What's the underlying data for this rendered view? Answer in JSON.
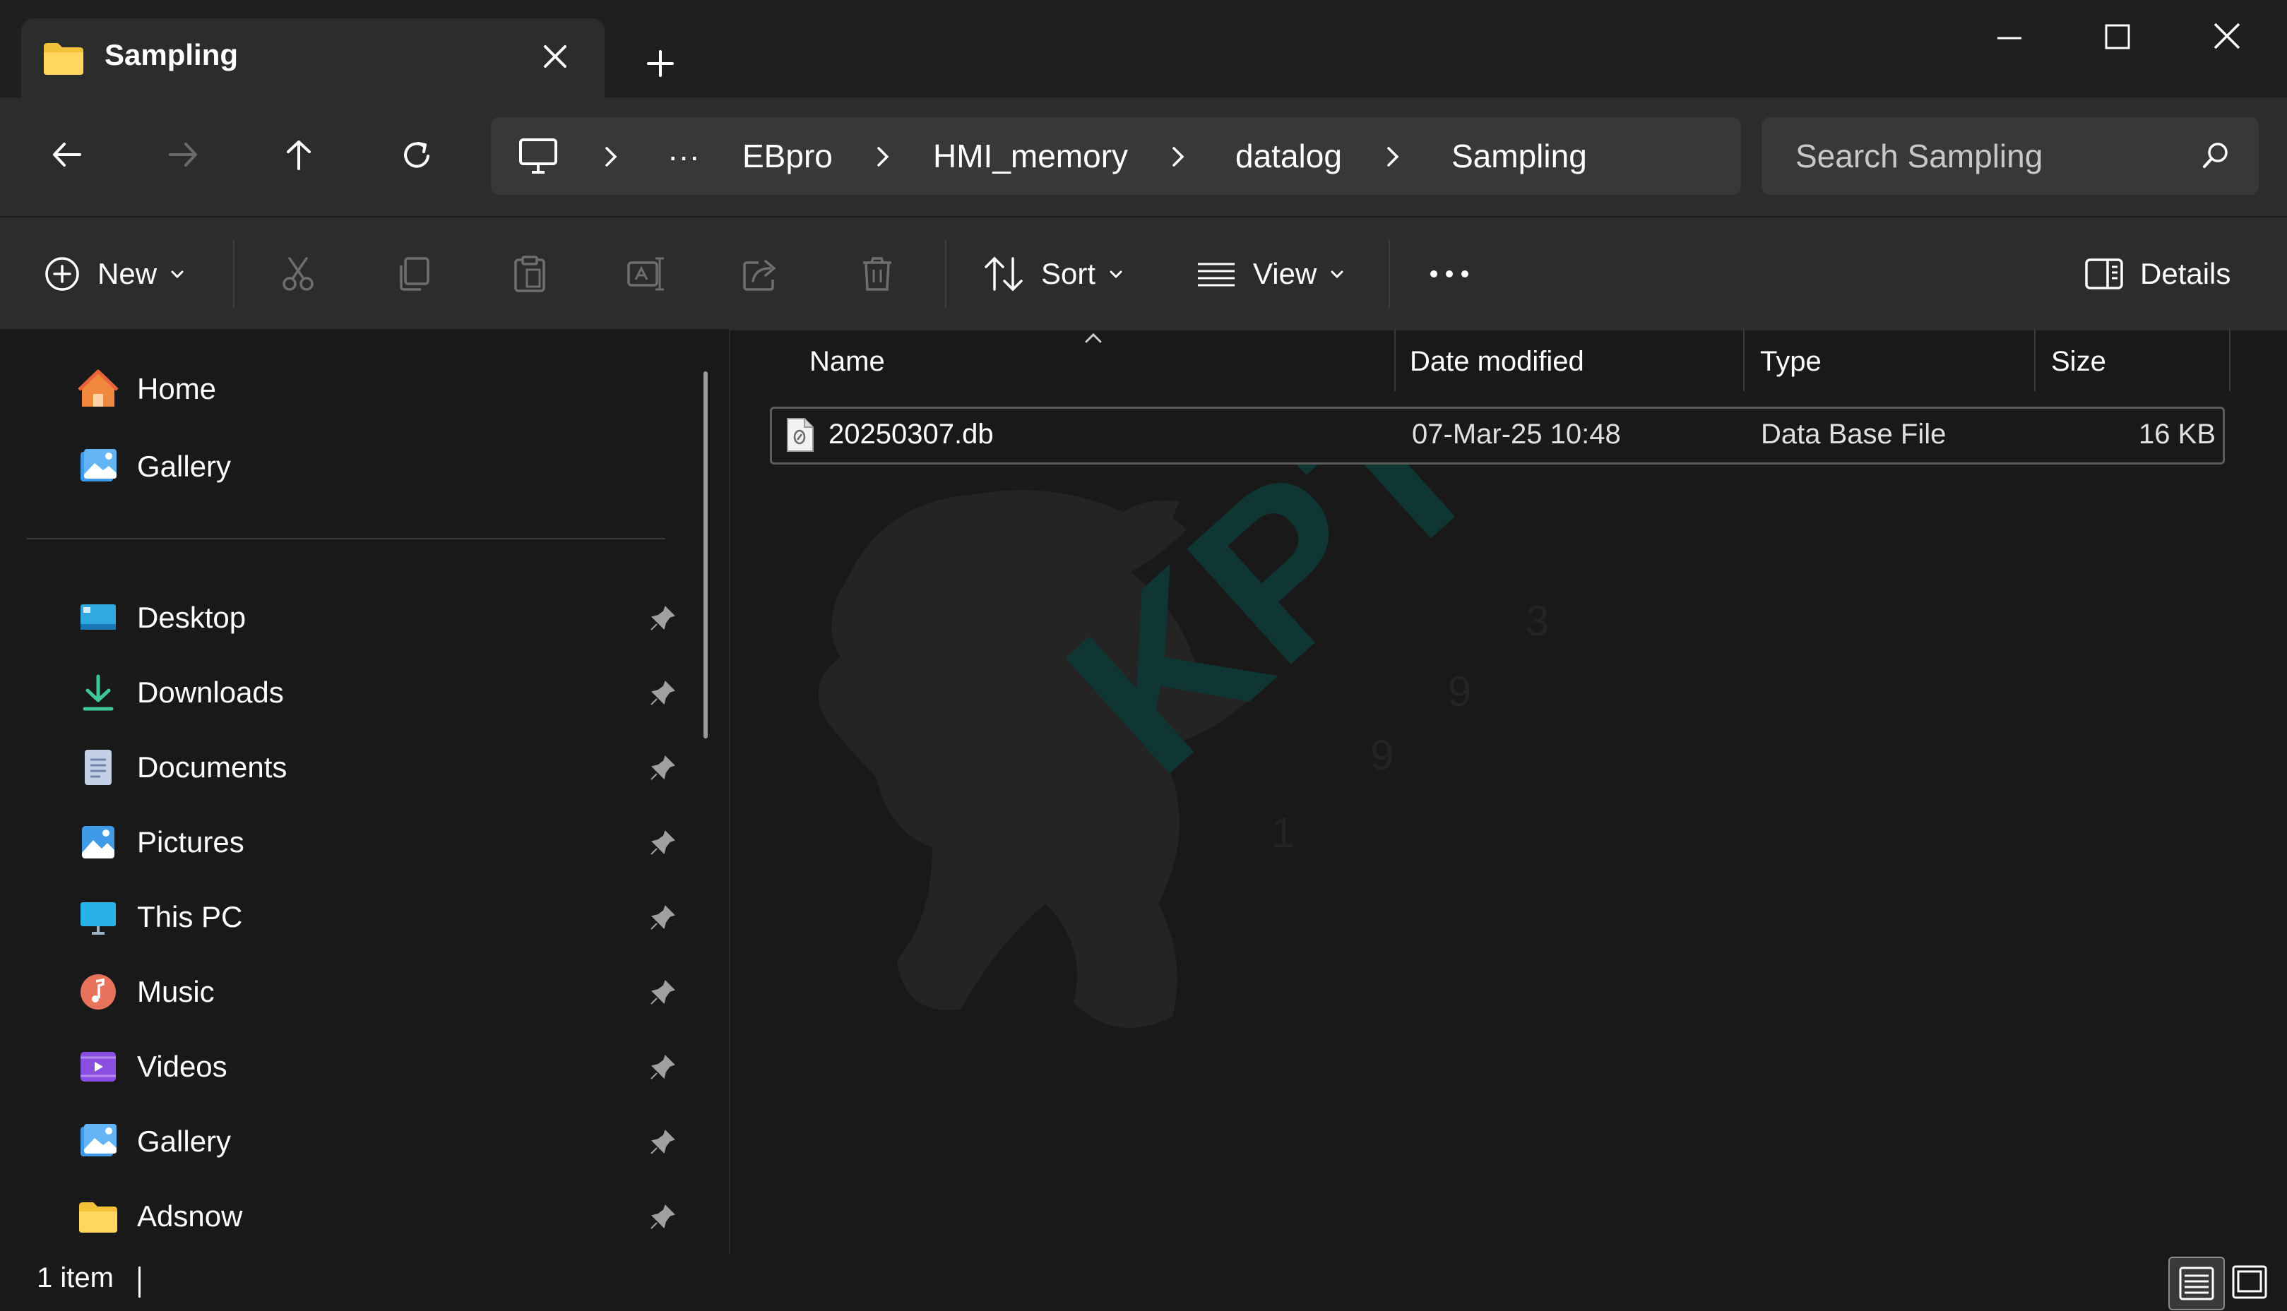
{
  "window": {
    "tab_title": "Sampling"
  },
  "address_bar": {
    "overflow": "···",
    "crumbs": [
      "EBpro",
      "HMI_memory",
      "datalog",
      "Sampling"
    ]
  },
  "search": {
    "placeholder": "Search Sampling"
  },
  "command_bar": {
    "new_label": "New",
    "sort_label": "Sort",
    "view_label": "View",
    "details_label": "Details"
  },
  "sidebar": {
    "top_items": [
      {
        "label": "Home",
        "icon": "home-icon"
      },
      {
        "label": "Gallery",
        "icon": "gallery-icon"
      }
    ],
    "pinned_items": [
      {
        "label": "Desktop",
        "icon": "desktop-icon"
      },
      {
        "label": "Downloads",
        "icon": "downloads-icon"
      },
      {
        "label": "Documents",
        "icon": "documents-icon"
      },
      {
        "label": "Pictures",
        "icon": "pictures-icon"
      },
      {
        "label": "This PC",
        "icon": "this-pc-icon"
      },
      {
        "label": "Music",
        "icon": "music-icon"
      },
      {
        "label": "Videos",
        "icon": "videos-icon"
      },
      {
        "label": "Gallery",
        "icon": "gallery-icon"
      },
      {
        "label": "Adsnow",
        "icon": "folder-icon"
      }
    ]
  },
  "file_list": {
    "columns": [
      "Name",
      "Date modified",
      "Type",
      "Size"
    ],
    "rows": [
      {
        "name": "20250307.db",
        "date_modified": "07-Mar-25 10:48",
        "type": "Data Base File",
        "size": "16 KB"
      }
    ]
  },
  "status": {
    "item_count": "1 item"
  },
  "colors": {
    "background": "#191919",
    "toolbar": "#2c2c2c",
    "field": "#383838",
    "folder_yellow": "#f4c13a",
    "watermark_teal": "#0f3a36"
  }
}
